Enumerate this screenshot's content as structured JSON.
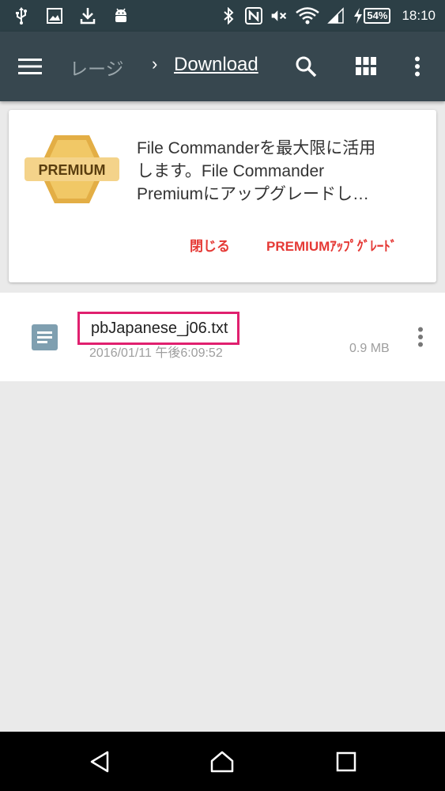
{
  "status_bar": {
    "left_icons": [
      "usb-icon",
      "image-icon",
      "download-icon",
      "android-icon"
    ],
    "right_icons": [
      "bluetooth-icon",
      "nfc-icon",
      "mute-icon",
      "wifi-icon",
      "signal-icon",
      "charging-icon"
    ],
    "battery": "54%",
    "time": "18:10"
  },
  "app_bar": {
    "breadcrumb_prev": "ストレージ",
    "breadcrumb_prev_visible": "レージ",
    "separator": "›",
    "breadcrumb_current": "Download",
    "actions": [
      "search-icon",
      "grid-view-icon",
      "more-icon"
    ]
  },
  "promo": {
    "badge_text": "PREMIUM",
    "message_line1": "File Commanderを最大限に活用",
    "message_line2": "します。File Commander",
    "message_line3": "Premiumにアップグレードし…",
    "close_label": "閉じる",
    "upgrade_label": "PREMIUMｱｯﾌﾟｸﾞﾚｰﾄﾞ"
  },
  "files": [
    {
      "name": "pbJapanese_j06.txt",
      "date": "2016/01/11 午後6:09:52",
      "size": "0.9 MB"
    }
  ],
  "colors": {
    "status_bar": "#2c3f46",
    "app_bar": "#37474f",
    "accent_red": "#e53935",
    "highlight_box": "#e0206f",
    "badge_gold": "#e8b84a"
  },
  "nav_bar": [
    "back-icon",
    "home-icon",
    "recents-icon"
  ]
}
